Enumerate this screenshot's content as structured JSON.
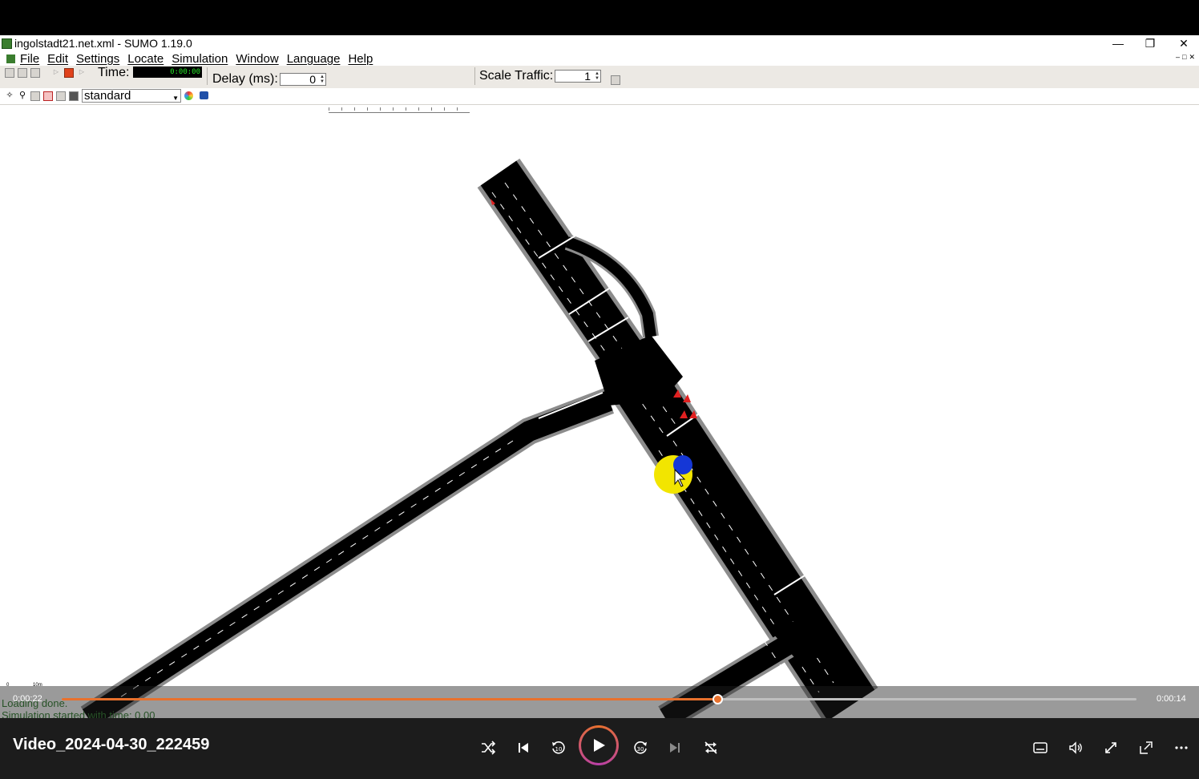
{
  "window": {
    "title": "ingolstadt21.net.xml - SUMO 1.19.0"
  },
  "menu": {
    "items": [
      "File",
      "Edit",
      "Settings",
      "Locate",
      "Simulation",
      "Window",
      "Language",
      "Help"
    ]
  },
  "toolbar": {
    "time_label": "Time:",
    "time_value": "0:00:00",
    "delay_label": "Delay (ms):",
    "delay_value": "0",
    "scale_label": "Scale Traffic:",
    "scale_value": "1"
  },
  "view": {
    "scheme": "standard"
  },
  "canvas": {
    "scale_zero": "0",
    "scale_length": "10m",
    "message_1": "Loading done.",
    "message_2": "Simulation started with time: 0.00"
  },
  "player": {
    "elapsed": "0:00:22",
    "remaining": "0:00:14",
    "progress": 0.61,
    "video_title": "Video_2024-04-30_222459"
  },
  "colors": {
    "accent": "#e8712d",
    "road": "#000000",
    "sidewalk": "#8c8c8c",
    "highlight": "#f2e500",
    "vehicle_focus": "#1537d6",
    "vehicle": "#e02020"
  }
}
